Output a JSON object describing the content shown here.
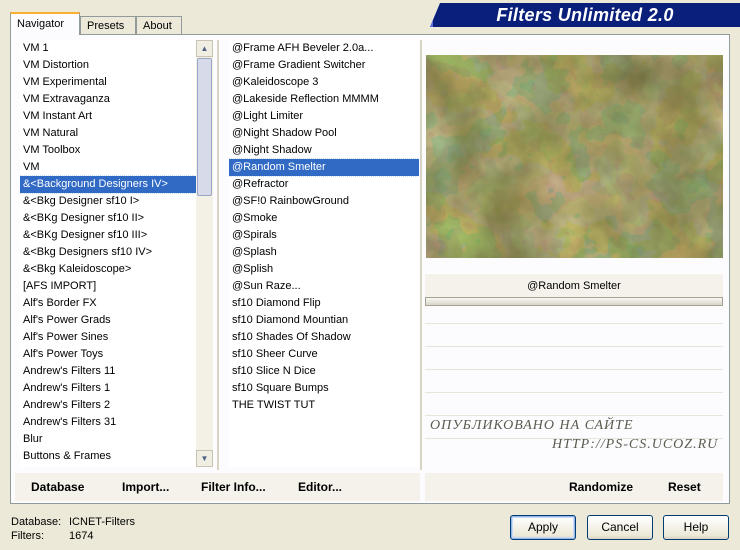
{
  "app": {
    "title": "Filters Unlimited 2.0"
  },
  "tabs": [
    {
      "label": "Navigator",
      "active": true
    },
    {
      "label": "Presets",
      "active": false
    },
    {
      "label": "About",
      "active": false
    }
  ],
  "categories": [
    "VM 1",
    "VM Distortion",
    "VM Experimental",
    "VM Extravaganza",
    "VM Instant Art",
    "VM Natural",
    "VM Toolbox",
    "VM",
    "&<Background Designers IV>",
    "&<Bkg Designer sf10 I>",
    "&<BKg Designer sf10 II>",
    "&<BKg Designer sf10 III>",
    "&<Bkg Designers sf10 IV>",
    "&<Bkg Kaleidoscope>",
    "[AFS IMPORT]",
    "Alf's Border FX",
    "Alf's Power Grads",
    "Alf's Power Sines",
    "Alf's Power Toys",
    "Andrew's Filters 11",
    "Andrew's Filters 1",
    "Andrew's Filters 2",
    "Andrew's Filters 31",
    "Blur",
    "Buttons & Frames"
  ],
  "selected_category": "&<Background Designers IV>",
  "filters": [
    "@Frame AFH Beveler 2.0a...",
    "@Frame Gradient Switcher",
    "@Kaleidoscope 3",
    "@Lakeside Reflection MMMM",
    "@Light Limiter",
    "@Night Shadow Pool",
    "@Night Shadow",
    "@Random Smelter",
    "@Refractor",
    "@SF!0 RainbowGround",
    "@Smoke",
    "@Spirals",
    "@Splash",
    "@Splish",
    "@Sun Raze...",
    "sf10 Diamond Flip",
    "sf10 Diamond Mountian",
    "sf10 Shades Of Shadow",
    "sf10 Sheer Curve",
    "sf10 Slice N Dice",
    "sf10 Square Bumps",
    "THE TWIST TUT"
  ],
  "selected_filter": "@Random Smelter",
  "preview": {
    "filter_name": "@Random Smelter"
  },
  "watermark": {
    "line1": "ОПУБЛИКОВАНО    НА САЙТЕ",
    "line2": "HTTP://PS-CS.UCOZ.RU"
  },
  "toolbar": {
    "database": "Database",
    "import": "Import...",
    "filter_info": "Filter Info...",
    "editor": "Editor...",
    "randomize": "Randomize",
    "reset": "Reset"
  },
  "footer": {
    "database_label": "Database:",
    "database_value": "ICNET-Filters",
    "filters_label": "Filters:",
    "filters_value": "1674"
  },
  "buttons": {
    "apply": "Apply",
    "cancel": "Cancel",
    "help": "Help"
  },
  "colors": {
    "banner": "#0a1f7a",
    "selection": "#316ac5",
    "tab_accent": "#f9b030"
  }
}
